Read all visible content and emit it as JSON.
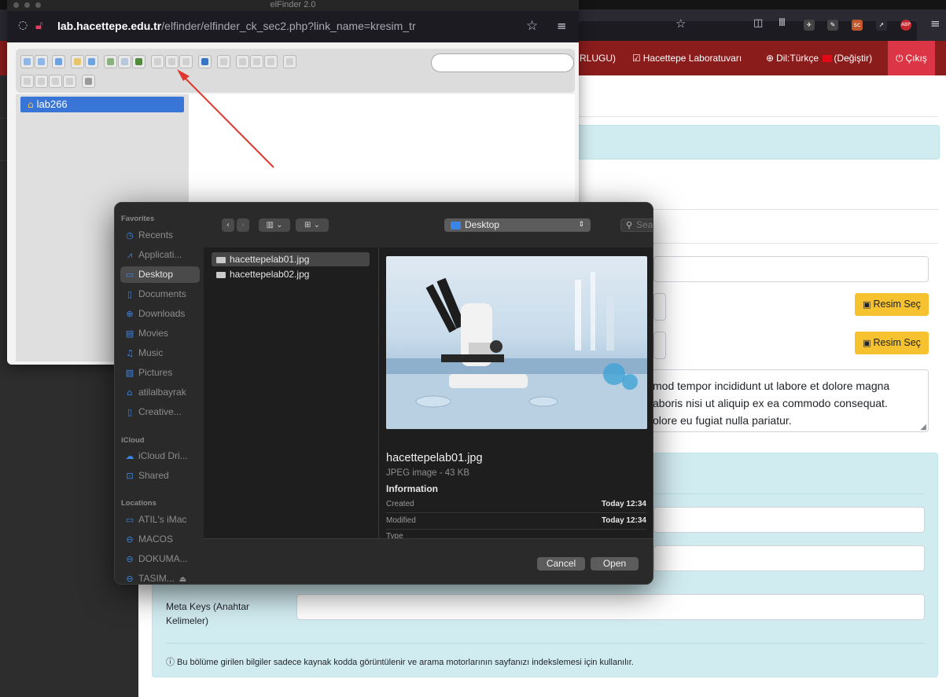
{
  "browser": {
    "elfinder_title": "elFinder 2.0",
    "url_host": "lab.hacettepe.edu.tr",
    "url_path": "/elfinder/elfinder_ck_sec2.php?link_name=kresim_tr",
    "extensions": [
      "sc",
      "ABP"
    ]
  },
  "nav": {
    "partial_item": "RLUGU)",
    "lab_item": "Hacettepe Laboratuvarı",
    "lang_prefix": "Dil:Türkçe",
    "lang_change": "(Değiştir)",
    "logout": "Çıkış"
  },
  "form": {
    "image_button_1": "Resim Seç",
    "image_button_2": "Resim Seç",
    "lorem_lines": [
      "mod tempor incididunt ut labore et dolore magna",
      "aboris nisi ut aliquip ex ea commodo consequat.",
      "olore eu fugiat nulla pariatur."
    ],
    "meta_keys_label": "Meta Keys (Anahtar Kelimeler)",
    "seo_note": "Bu bölüme girilen bilgiler sadece kaynak kodda görüntülenir ve arama motorlarının sayfanızı indekslemesi için kullanılır."
  },
  "elfinder": {
    "tree_root": "lab266"
  },
  "dialog": {
    "sidebar": {
      "favorites_header": "Favorites",
      "favorites": [
        {
          "label": "Recents",
          "icon": "clock-icon"
        },
        {
          "label": "Applicati...",
          "icon": "applications-icon"
        },
        {
          "label": "Desktop",
          "icon": "desktop-icon",
          "selected": true
        },
        {
          "label": "Documents",
          "icon": "document-icon"
        },
        {
          "label": "Downloads",
          "icon": "download-icon"
        },
        {
          "label": "Movies",
          "icon": "film-icon"
        },
        {
          "label": "Music",
          "icon": "music-icon"
        },
        {
          "label": "Pictures",
          "icon": "picture-icon"
        },
        {
          "label": "atilalbayrak",
          "icon": "home-icon"
        },
        {
          "label": "Creative...",
          "icon": "document-icon"
        }
      ],
      "icloud_header": "iCloud",
      "icloud": [
        {
          "label": "iCloud Dri...",
          "icon": "cloud-icon"
        },
        {
          "label": "Shared",
          "icon": "shared-folder-icon"
        }
      ],
      "locations_header": "Locations",
      "locations": [
        {
          "label": "ATIL's iMac",
          "icon": "computer-icon"
        },
        {
          "label": "MACOS",
          "icon": "drive-icon"
        },
        {
          "label": "DOKUMA...",
          "icon": "drive-icon"
        },
        {
          "label": "TASIM...",
          "icon": "drive-icon"
        }
      ]
    },
    "location": "Desktop",
    "search_placeholder": "Search",
    "files": [
      "hacettepelab01.jpg",
      "hacettepelab02.jpg"
    ],
    "selected_file": 0,
    "preview": {
      "name": "hacettepelab01.jpg",
      "kind": "JPEG image - 43 KB",
      "info_header": "Information",
      "rows": [
        {
          "key": "Created",
          "value": "Today 12:34"
        },
        {
          "key": "Modified",
          "value": "Today 12:34"
        }
      ],
      "cut_label": "Type"
    },
    "cancel": "Cancel",
    "open": "Open"
  },
  "colors": {
    "nav_bg": "#8b1c1c",
    "logout_bg": "#dc3545",
    "warning_btn": "#f7c230",
    "info_bg": "#d1ecf1",
    "selection_blue": "#3875d7",
    "annotation_arrow": "#e0382f"
  }
}
